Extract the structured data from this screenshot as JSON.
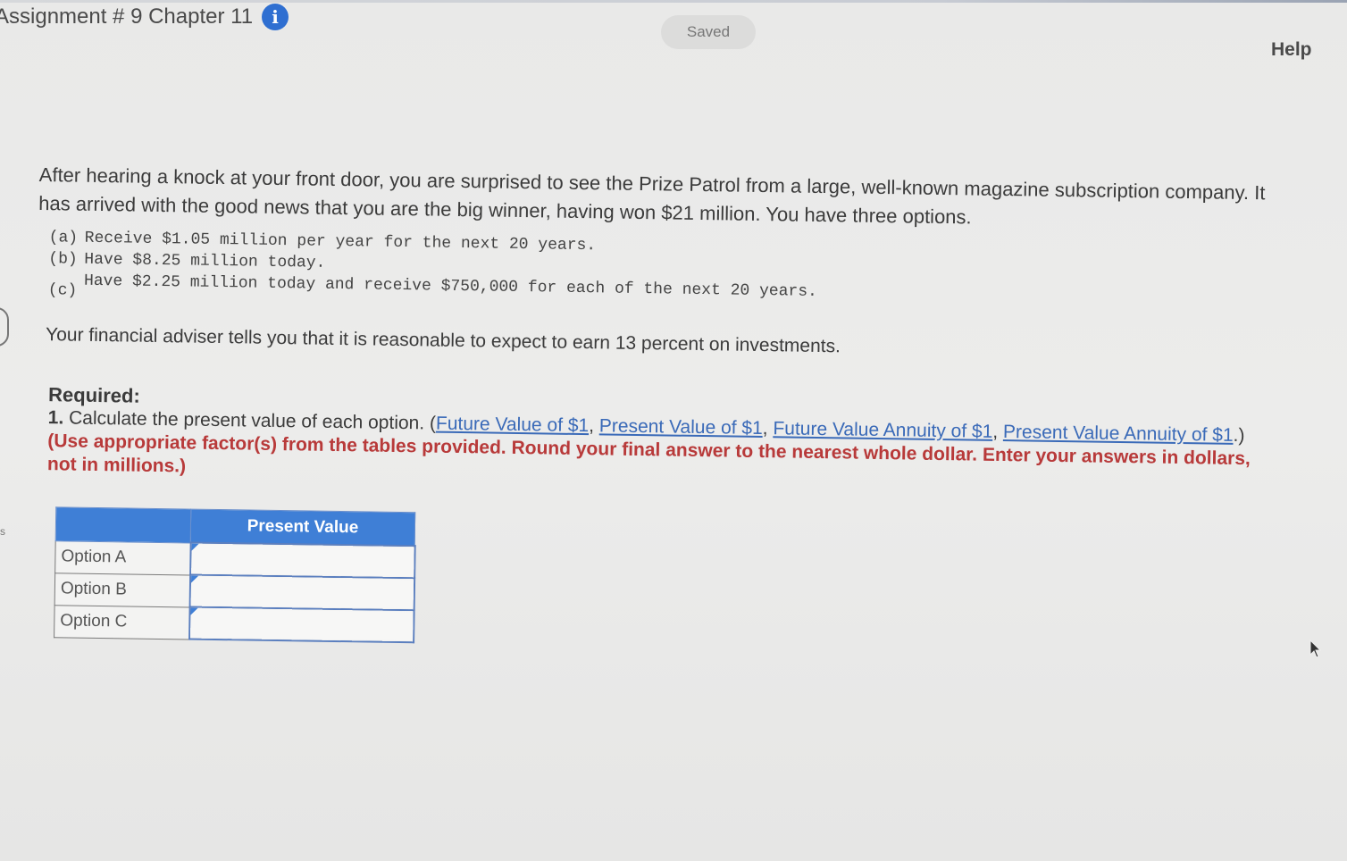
{
  "header": {
    "title": "Assignment # 9 Chapter 11",
    "saved_label": "Saved",
    "help_label": "Help"
  },
  "question": {
    "intro": "After hearing a knock at your front door, you are surprised to see the Prize Patrol from a large, well-known magazine subscription company. It has arrived with the good news that you are the big winner, having won $21 million. You have three options.",
    "options": [
      {
        "label": "(a)",
        "text": "Receive $1.05 million per year for the next 20 years."
      },
      {
        "label": "(b)",
        "text": "Have $8.25 million today."
      },
      {
        "label": "(c)",
        "text": "Have $2.25 million today and receive $750,000 for each of the next 20 years."
      }
    ],
    "adviser": "Your financial adviser tells you that it is reasonable to expect to earn 13 percent on investments."
  },
  "required": {
    "heading": "Required:",
    "number": "1.",
    "text": "Calculate the present value of each option.",
    "links": [
      "Future Value of $1",
      "Present Value of $1",
      "Future Value Annuity of $1",
      "Present Value Annuity of $1"
    ],
    "note": "(Use appropriate factor(s) from the tables provided. Round your final answer to the nearest whole dollar. Enter your answers in dollars, not in millions.)"
  },
  "table": {
    "column_header": "Present Value",
    "rows": [
      {
        "label": "Option A",
        "value": ""
      },
      {
        "label": "Option B",
        "value": ""
      },
      {
        "label": "Option C",
        "value": ""
      }
    ]
  },
  "icons": {
    "info": "info-icon",
    "cursor": "mouse-cursor-icon"
  },
  "colors": {
    "accent_blue": "#3f7fd6",
    "link_blue": "#3a6ab8",
    "note_red": "#b83a3a"
  }
}
